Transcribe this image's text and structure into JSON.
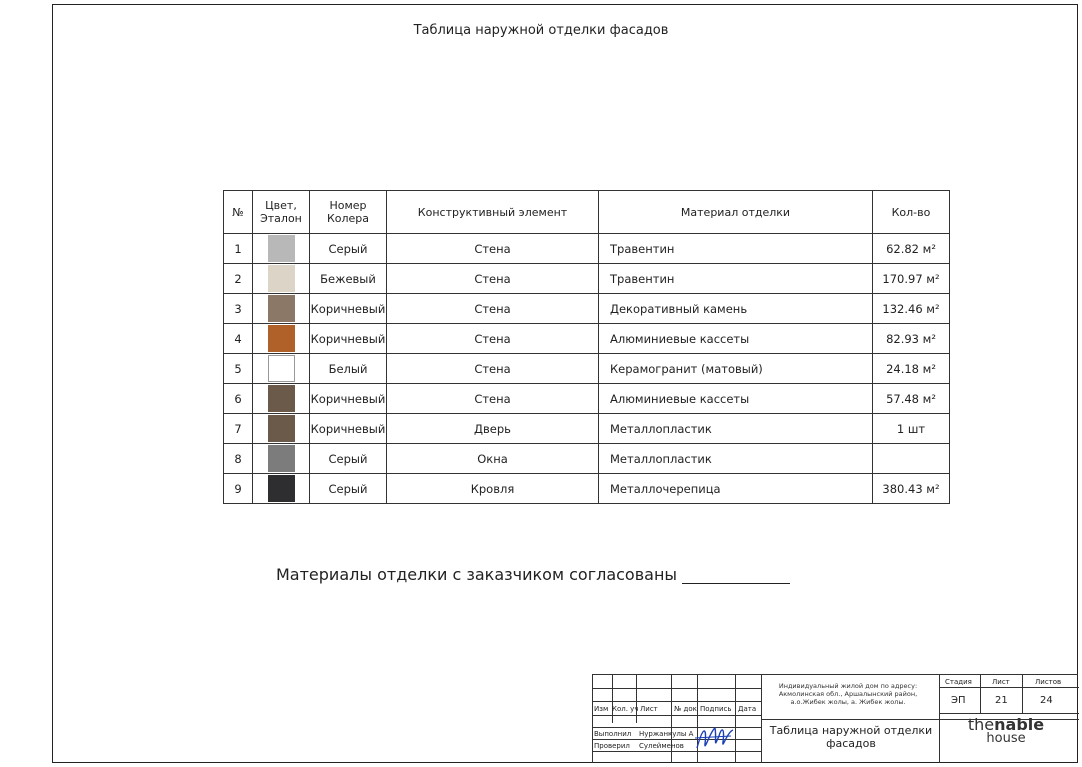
{
  "title": "Таблица наружной отделки фасадов",
  "table": {
    "headers": {
      "num": "№",
      "color_line1": "Цвет,",
      "color_line2": "Эталон",
      "code_line1": "Номер",
      "code_line2": "Колера",
      "element": "Конструктивный элемент",
      "material": "Материал отделки",
      "qty": "Кол-во"
    },
    "rows": [
      {
        "num": "1",
        "swatch_color": "#b8b8b8",
        "color_name": "Серый",
        "element": "Стена",
        "material": "Травентин",
        "qty": "62.82 м²"
      },
      {
        "num": "2",
        "swatch_color": "#ddd4c8",
        "color_name": "Бежевый",
        "element": "Стена",
        "material": "Травентин",
        "qty": "170.97  м²"
      },
      {
        "num": "3",
        "swatch_color": "#8c7866",
        "color_name": "Коричневый",
        "element": "Стена",
        "material": "Декоративный камень",
        "qty": "132.46 м²"
      },
      {
        "num": "4",
        "swatch_color": "#b0612a",
        "color_name": "Коричневый",
        "element": "Стена",
        "material": "Алюминиевые  кассеты",
        "qty": "82.93 м²"
      },
      {
        "num": "5",
        "swatch_color": "#ffffff",
        "color_name": "Белый",
        "element": "Стена",
        "material": "Керамогранит (матовый)",
        "qty": "24.18 м²"
      },
      {
        "num": "6",
        "swatch_color": "#6b5a49",
        "color_name": "Коричневый",
        "element": "Стена",
        "material": "Алюминиевые  кассеты",
        "qty": "57.48 м²"
      },
      {
        "num": "7",
        "swatch_color": "#6b5a49",
        "color_name": "Коричневый",
        "element": "Дверь",
        "material": "Металлопластик",
        "qty": "1 шт"
      },
      {
        "num": "8",
        "swatch_color": "#7c7c7c",
        "color_name": "Серый",
        "element": "Окна",
        "material": "Металлопластик",
        "qty": ""
      },
      {
        "num": "9",
        "swatch_color": "#2e2e30",
        "color_name": "Серый",
        "element": "Кровля",
        "material": "Металлочерепица",
        "qty": "380.43 м²"
      }
    ]
  },
  "agreement_text": "Материалы отделки с заказчиком согласованы",
  "title_block": {
    "col_izm": "Изм",
    "col_kol": "Кол. уч",
    "col_list": "Лист",
    "col_ndok": "№ док",
    "col_podpis": "Подпись",
    "col_data": "Дата",
    "role_executed": "Выполнил",
    "name_executed": "Нуржанкулы А",
    "role_checked": "Проверил",
    "name_checked": "Сулейменов",
    "address_line1": "Индивидуальный жилой дом по адресу:",
    "address_line2": "Акмолинская обл., Аршалынский район,",
    "address_line3": "а.о.Жибек жолы, а. Жибек жолы.",
    "stage_label": "Стадия",
    "sheet_label": "Лист",
    "sheets_label": "Листов",
    "stage_value": "ЭП",
    "sheet_value": "21",
    "sheets_value": "24",
    "drawing_name_line1": "Таблица наружной отделки",
    "drawing_name_line2": "фасадов",
    "logo_the": "the",
    "logo_nable": "nable",
    "logo_house": "house"
  }
}
